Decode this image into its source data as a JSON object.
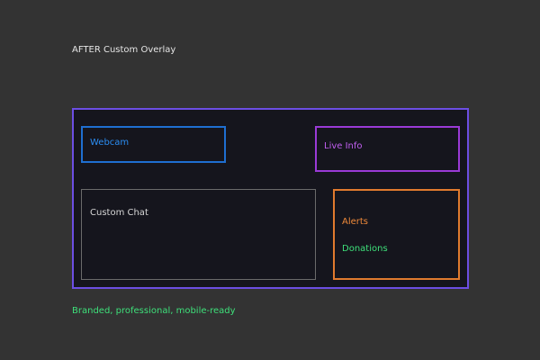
{
  "heading": {
    "title": "AFTER Custom Overlay"
  },
  "overlay": {
    "webcam_label": "Webcam",
    "live_info_label": "Live Info",
    "custom_chat_label": "Custom Chat",
    "alerts_label": "Alerts",
    "donations_label": "Donations"
  },
  "footer": {
    "tagline": "Branded, professional, mobile-ready"
  },
  "colors": {
    "background": "#333333",
    "overlay_border": "#6c4ee3",
    "overlay_fill": "#15151d",
    "webcam_border": "#1f6fd1",
    "live_info_border": "#9a3ad6",
    "chat_border": "#6b6b6b",
    "alerts_border": "#e07a2e",
    "donations_text": "#3ee07a"
  }
}
